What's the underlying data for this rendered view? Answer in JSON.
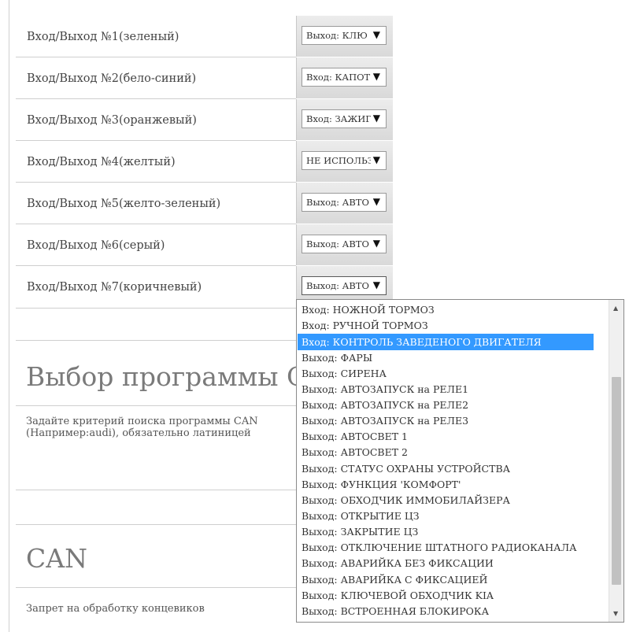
{
  "io_rows": [
    {
      "label": "Вход/Выход №1(зеленый)",
      "value": "Выход: КЛЮ"
    },
    {
      "label": "Вход/Выход №2(бело-синий)",
      "value": "Вход: КАПОТ"
    },
    {
      "label": "Вход/Выход №3(оранжевый)",
      "value": "Вход: ЗАЖИГ"
    },
    {
      "label": "Вход/Выход №4(желтый)",
      "value": "НЕ ИСПОЛЬЗ"
    },
    {
      "label": "Вход/Выход №5(желто-зеленый)",
      "value": "Выход: АВТО"
    },
    {
      "label": "Вход/Выход №6(серый)",
      "value": "Выход: АВТО"
    },
    {
      "label": "Вход/Выход №7(коричневый)",
      "value": "Выход: АВТО"
    }
  ],
  "sections": {
    "program_title": "Выбор программы C",
    "program_desc": "Задайте критерий поиска программы CAN (Например:audi), обязательно латиницей",
    "can_title": "CAN",
    "can_desc": "Запрет на обработку концевиков"
  },
  "dropdown": {
    "options": [
      "Вход: НОЖНОЙ ТОРМОЗ",
      "Вход: РУЧНОЙ ТОРМОЗ",
      "Вход: КОНТРОЛЬ ЗАВЕДЕНОГО ДВИГАТЕЛЯ",
      "Выход: ФАРЫ",
      "Выход: СИРЕНА",
      "Выход: АВТОЗАПУСК на РЕЛЕ1",
      "Выход: АВТОЗАПУСК на РЕЛЕ2",
      "Выход: АВТОЗАПУСК на РЕЛЕ3",
      "Выход: АВТОСВЕТ 1",
      "Выход: АВТОСВЕТ 2",
      "Выход: СТАТУС ОХРАНЫ УСТРОЙСТВА",
      "Выход: ФУНКЦИЯ 'КОМФОРТ'",
      "Выход: ОБХОДЧИК ИММОБИЛАЙЗЕРА",
      "Выход: ОТКРЫТИЕ ЦЗ",
      "Выход: ЗАКРЫТИЕ ЦЗ",
      "Выход: ОТКЛЮЧЕНИЕ ШТАТНОГО РАДИОКАНАЛА",
      "Выход: АВАРИЙКА БЕЗ ФИКСАЦИИ",
      "Выход: АВАРИЙКА С ФИКСАЦИЕЙ",
      "Выход: КЛЮЧЕВОЙ ОБХОДЧИК KIA",
      "Выход: ВСТРОЕННАЯ БЛОКИРОКА"
    ],
    "selected": "Вход: КОНТРОЛЬ ЗАВЕДЕНОГО ДВИГАТЕЛЯ"
  },
  "colors": {
    "highlight": "#3399ff"
  },
  "icons": {
    "select_arrow": "triangle-down-icon",
    "scroll_up": "scroll-up-arrow-icon",
    "scroll_down": "scroll-down-arrow-icon"
  }
}
